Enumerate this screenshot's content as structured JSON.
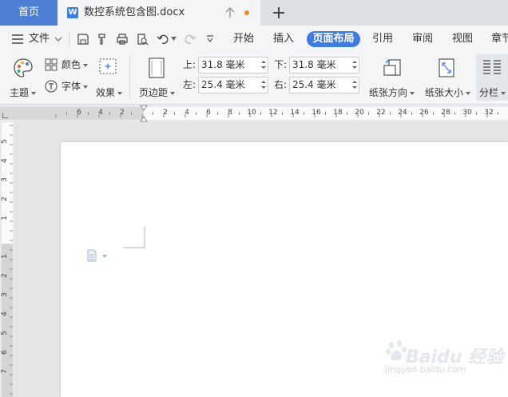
{
  "tabs": {
    "home_label": "首页",
    "doc_icon_letter": "W",
    "doc_title": "数控系统包含图.docx"
  },
  "menu": {
    "file_label": "文件",
    "tabs": [
      "开始",
      "插入",
      "页面布局",
      "引用",
      "审阅",
      "视图",
      "章节"
    ],
    "active_tab": "页面布局"
  },
  "ribbon": {
    "theme_label": "主题",
    "color_label": "颜色",
    "font_label": "字体",
    "effect_label": "效果",
    "margin_label": "页边距",
    "top_label": "上:",
    "top_value": "31.8 毫米",
    "bottom_label": "下:",
    "bottom_value": "31.8 毫米",
    "left_label": "左:",
    "left_value": "25.4 毫米",
    "right_label": "右:",
    "right_value": "25.4 毫米",
    "orientation_label": "纸张方向",
    "size_label": "纸张大小",
    "columns_label": "分栏"
  },
  "ruler": {
    "h_ticks": [
      "6",
      "4",
      "2",
      "2",
      "4",
      "6",
      "8",
      "10",
      "12",
      "14",
      "16",
      "18",
      "20",
      "22",
      "24",
      "26",
      "28",
      "30",
      "32"
    ],
    "v_ticks_top": [
      "5",
      "4",
      "3",
      "2",
      "1"
    ],
    "v_ticks_bottom": [
      "1",
      "2",
      "3",
      "4",
      "5",
      "6",
      "7"
    ]
  },
  "watermark": {
    "brand": "Baidu 经验",
    "url": "jingyan.baidu.com"
  },
  "colors": {
    "accent": "#3f7ce0",
    "home_tab": "#4d7fd4",
    "unsaved_dot": "#f08a24"
  }
}
